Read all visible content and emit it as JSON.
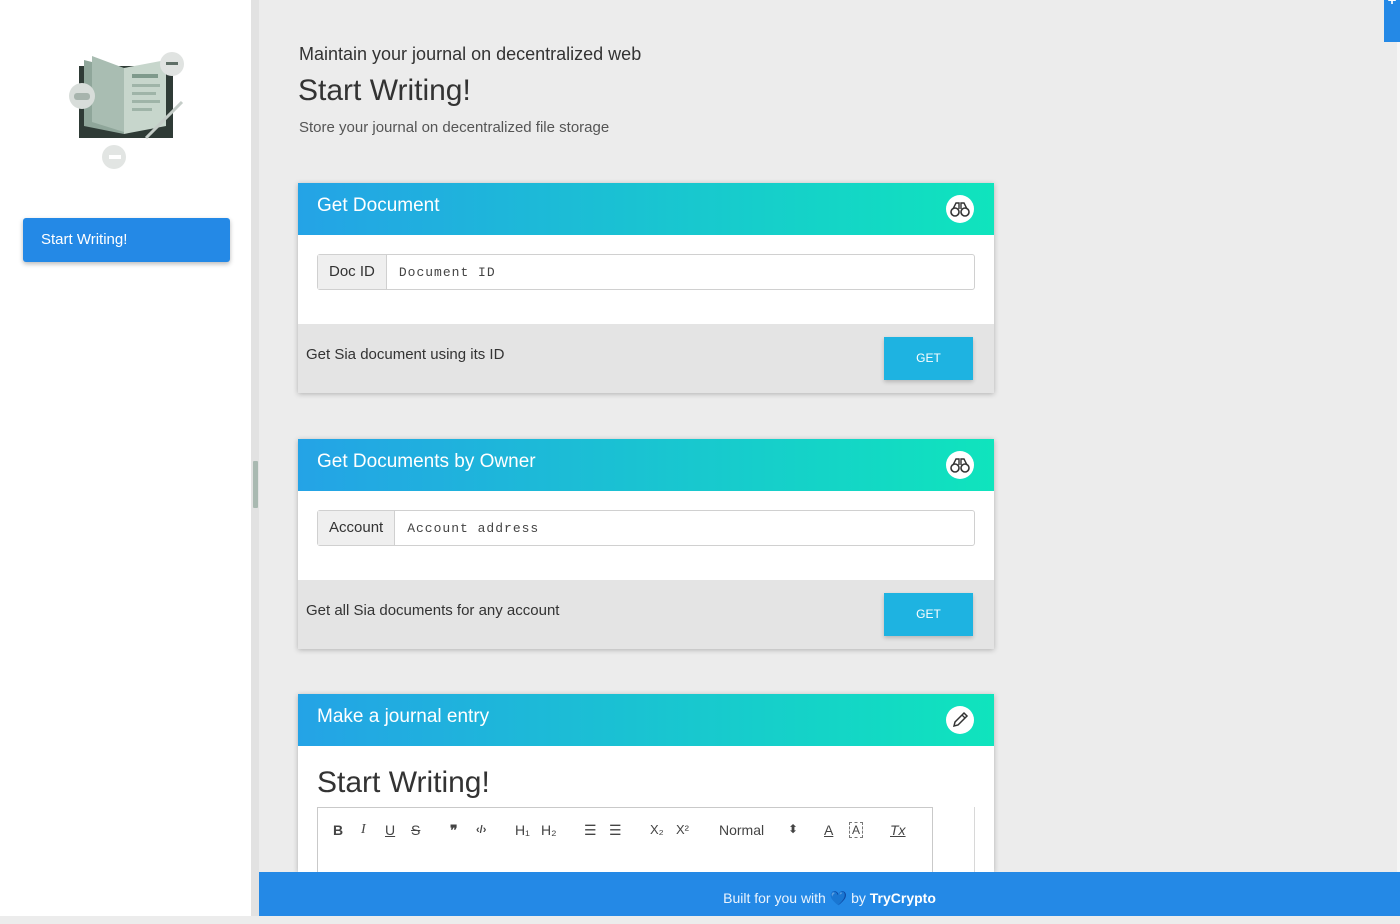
{
  "sidebar": {
    "logo_icon": "journal-illustration-icon",
    "nav_button": "Start Writing!"
  },
  "corner_button": "+",
  "hero": {
    "pretitle": "Maintain your journal on decentralized web",
    "title": "Start Writing!",
    "subtitle": "Store your journal on decentralized file storage"
  },
  "cards": [
    {
      "title": "Get Document",
      "icon": "binoculars-icon",
      "input_label": "Doc ID",
      "input_placeholder": "Document ID",
      "input_value": "",
      "footer_text": "Get Sia document using its ID",
      "button": "GET"
    },
    {
      "title": "Get Documents by Owner",
      "icon": "binoculars-icon",
      "input_label": "Account",
      "input_placeholder": "Account address",
      "input_value": "",
      "footer_text": "Get all Sia documents for any account",
      "button": "GET"
    },
    {
      "title": "Make a journal entry",
      "icon": "pencil-icon",
      "editor_title": "Start Writing!"
    }
  ],
  "toolbar": {
    "bold": "B",
    "italic": "I",
    "underline": "U",
    "strike": "S",
    "quote": "❞",
    "code": "‹/›",
    "h1": "H₁",
    "h2": "H₂",
    "ordered_list": "☰",
    "bullet_list": "☰",
    "subscript": "X₂",
    "superscript": "X²",
    "size_select": "Normal",
    "size_arrows": "⬍",
    "font_color": "A",
    "background_color": "A",
    "clean": "Tx"
  },
  "footer": {
    "prefix": "Built for you with",
    "heart": "💙",
    "by": "by",
    "brand": "TryCrypto"
  },
  "colors": {
    "accent": "#2489e6",
    "header_gradient_start": "#24a3e6",
    "header_gradient_end": "#0fe4bd",
    "get_button": "#1eb3e1"
  }
}
